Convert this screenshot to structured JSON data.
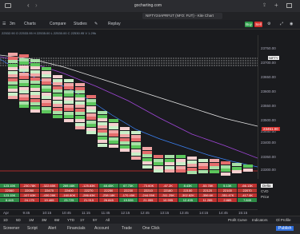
{
  "browser": {
    "url": "gocharting.com",
    "tab_title": "NIFTY24APRFUT (NFO: FUT) - Kite Chart"
  },
  "toolbar": {
    "interval": "3m",
    "charts_label": "Charts",
    "compare_label": "Compare",
    "studies_label": "Studies",
    "replay_label": "Replay",
    "buy_label": "Buy",
    "sell_label": "Sell"
  },
  "ohlc_text": "22532.90 O 22533.95 H 22535.00 L 22530.00 C 22530.95 V 1.29k",
  "price_axis": {
    "labels": [
      "23750.00",
      "23700.00",
      "23650.00",
      "23600.00",
      "23550.00",
      "23500.00",
      "23450.00",
      "23400.00",
      "23350.00",
      "23300.00"
    ],
    "symbol_tag": "NIFTY",
    "current_price": "23451.00",
    "current_price_color": "#e0302f"
  },
  "bottom_table": {
    "row1": [
      "123.15K",
      "-230.78K",
      "-322.65K",
      "269.48K",
      "-125.83K",
      "48.45K",
      "67.73K",
      "-73.60K",
      "-67.2K",
      "8.43K",
      "-53.78K",
      "5.13K",
      "-66.13K"
    ],
    "row2": [
      "22060",
      "22050",
      "22470",
      "22400",
      "22270",
      "22250",
      "22230",
      "22210",
      "22180",
      "22150",
      "22120",
      "22100",
      "22070"
    ],
    "row3": [
      "123.15K",
      "-107.63K",
      "-430.28K",
      "-160.80K",
      "-286.63K",
      "-238.18K",
      "-170.45K",
      "-244.05K",
      "-311.25K",
      "-302.82K",
      "-356.6K",
      "-351.47K",
      "-417.6K"
    ],
    "row4": [
      "8.445",
      "24.175",
      "19.465",
      "23.725",
      "21.915",
      "26.845",
      "19.535",
      "21.055",
      "10.995",
      "12.495",
      "11.285",
      "2.885",
      "7.845"
    ],
    "side_labels": [
      "Delta",
      "CVD",
      "Price"
    ]
  },
  "time_axis": [
    "Apr",
    "9:45",
    "10:15",
    "10:45",
    "11:15",
    "11:45",
    "12:15",
    "12:45",
    "13:15",
    "13:45",
    "14:15",
    "14:45",
    "15:15"
  ],
  "footer": {
    "items": [
      "1D",
      "5D",
      "1M",
      "3M",
      "6M",
      "YTD",
      "1Y",
      "5Y",
      "All"
    ],
    "right_items": [
      "Profit Curve",
      "Indicators",
      "Ol Profile"
    ]
  },
  "bottom_nav": [
    "Screener",
    "Script",
    "Alert",
    "Financials",
    "Account",
    "Trade",
    "One Click",
    "Publish"
  ]
}
